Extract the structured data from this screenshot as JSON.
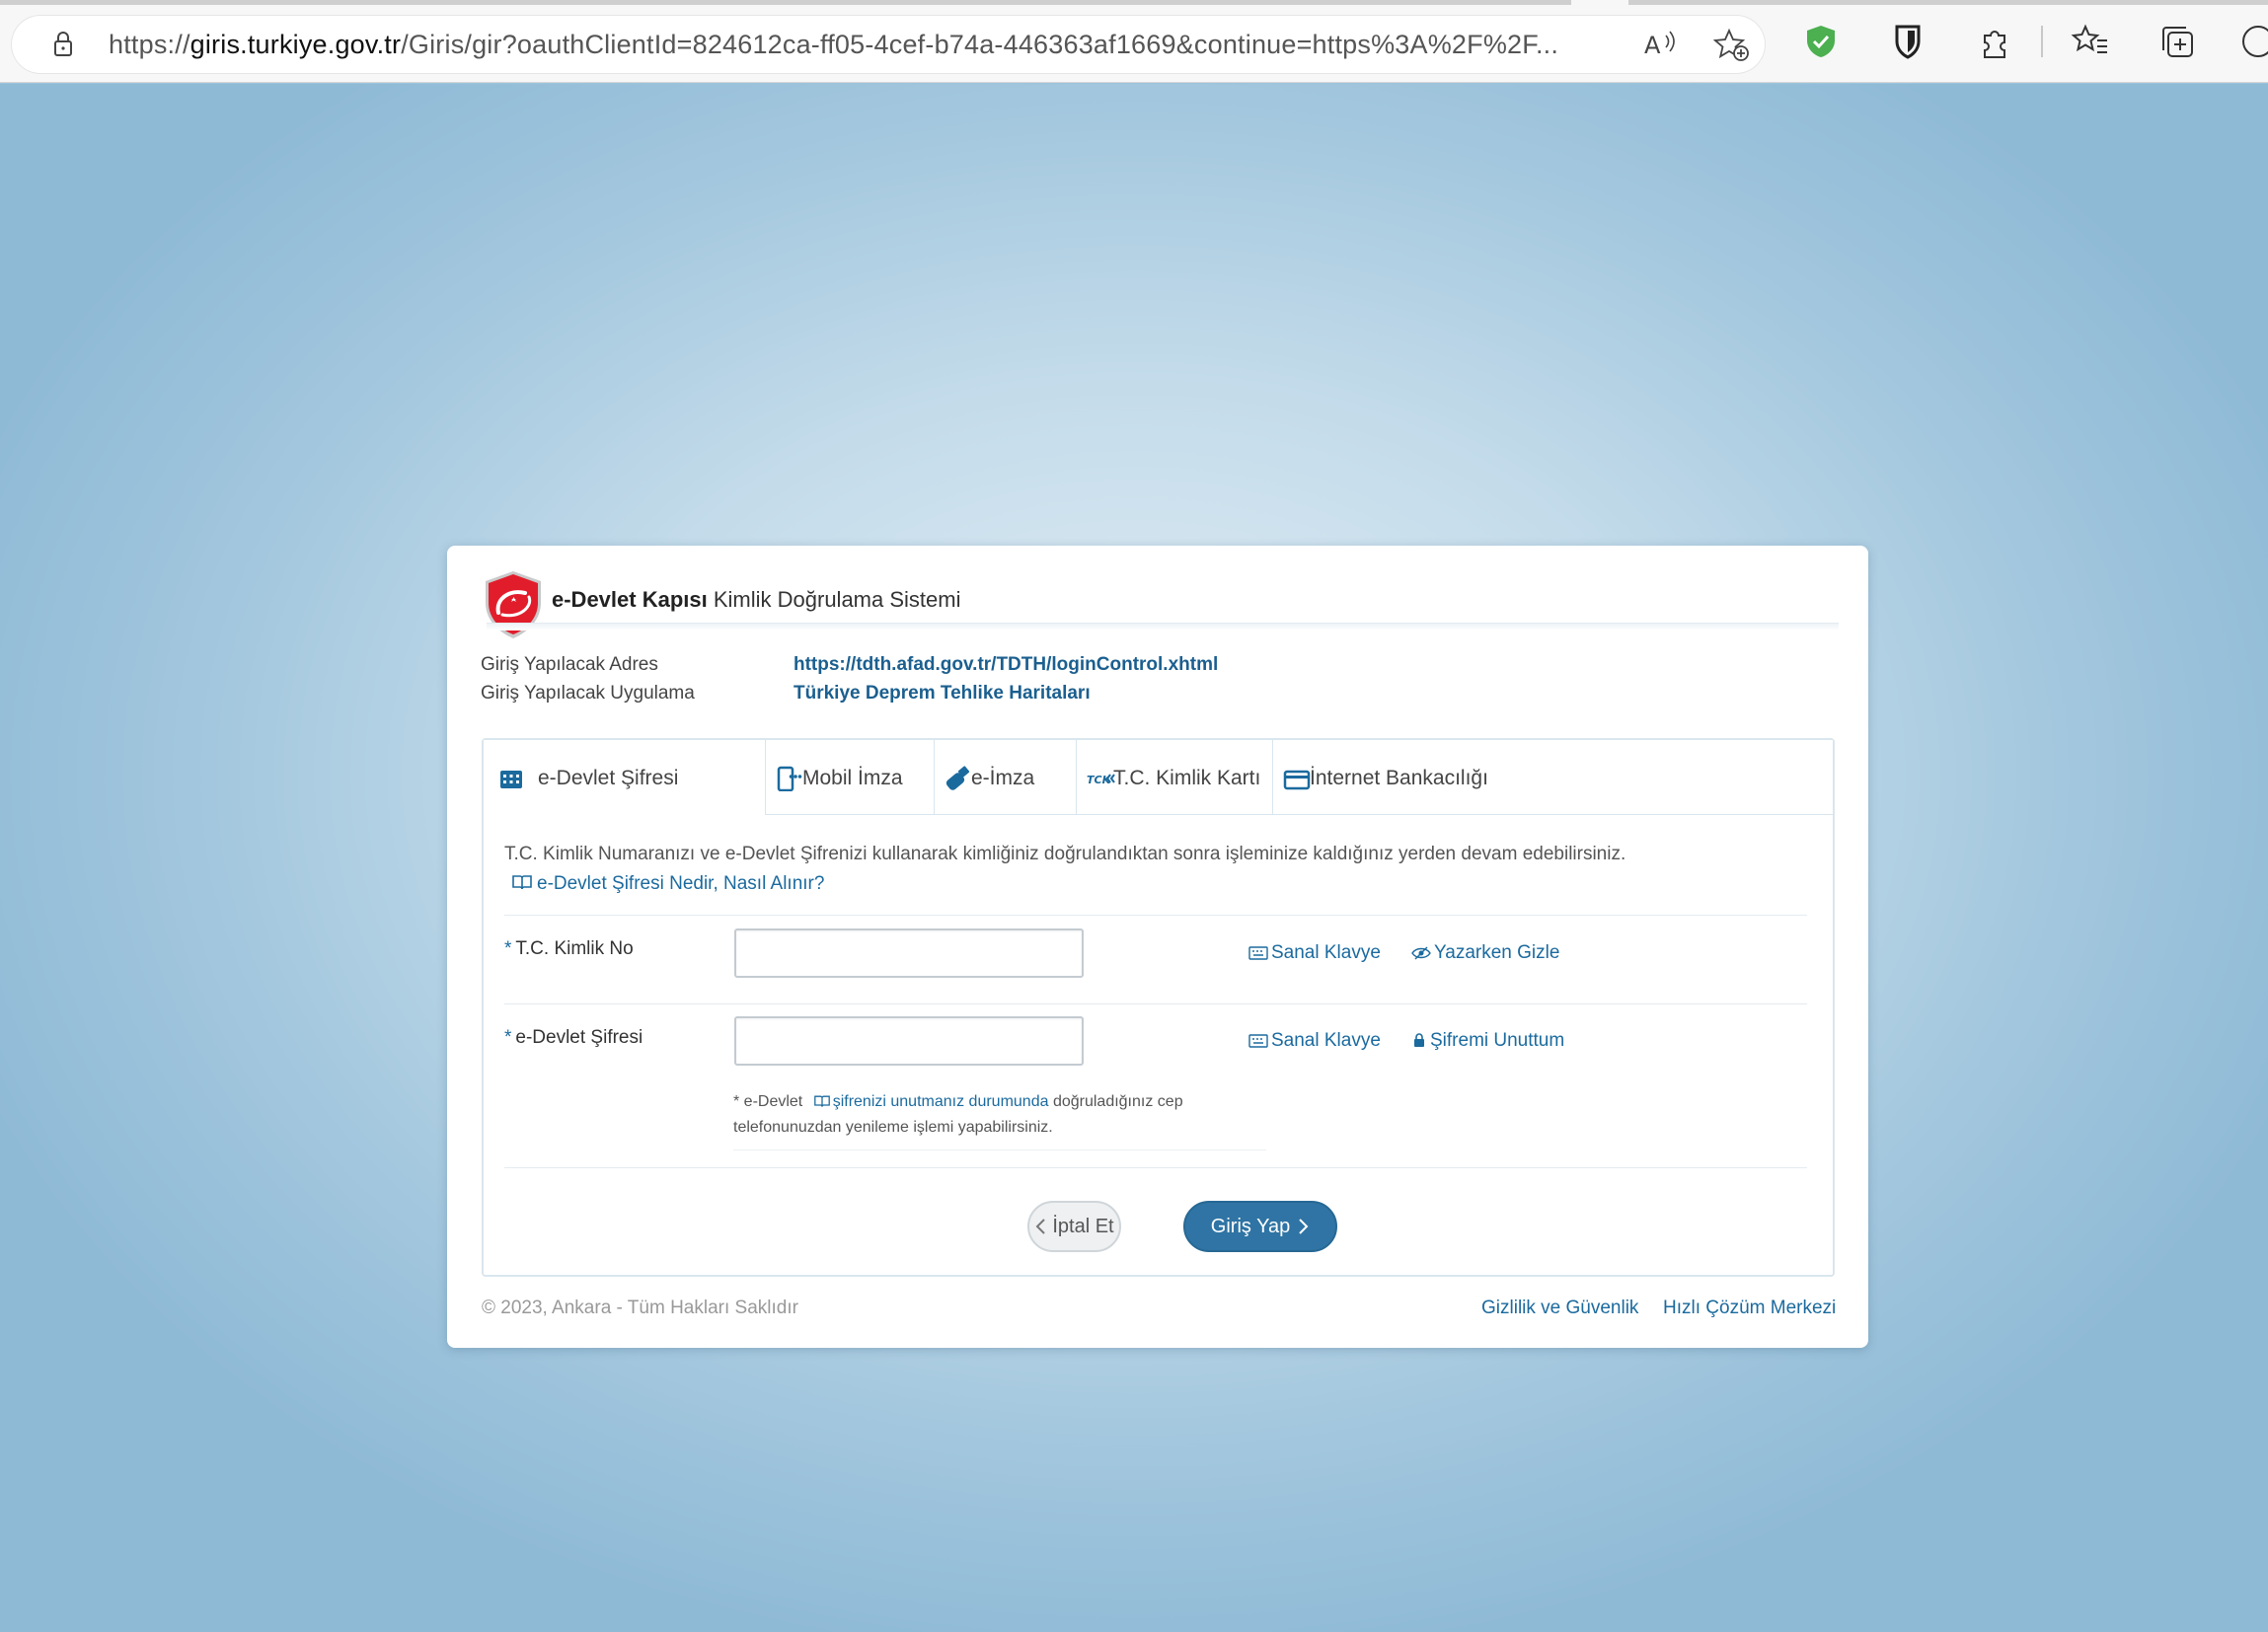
{
  "browser": {
    "url_prefix": "https://",
    "url_host": "giris.turkiye.gov.tr",
    "url_rest": "/Giris/gir?oauthClientId=824612ca-ff05-4cef-b74a-446363af1669&continue=https%3A%2F%2F...",
    "toolbar_icons": [
      "read-aloud-icon",
      "add-favorite-icon",
      "shield-extension-icon",
      "bitwarden-icon",
      "extensions-icon",
      "favorites-icon",
      "collections-icon",
      "profile-icon"
    ]
  },
  "header": {
    "brand_bold": "e-Devlet Kapısı",
    "brand_rest": "Kimlik Doğrulama Sistemi"
  },
  "info": {
    "address_label": "Giriş Yapılacak Adres",
    "address_value": "https://tdth.afad.gov.tr/TDTH/loginControl.xhtml",
    "app_label": "Giriş Yapılacak Uygulama",
    "app_value": "Türkiye Deprem Tehlike Haritaları"
  },
  "tabs": [
    {
      "label": "e-Devlet Şifresi",
      "icon": "keypad-icon",
      "active": true
    },
    {
      "label": "Mobil İmza",
      "icon": "mobile-signature-icon",
      "active": false
    },
    {
      "label": "e-İmza",
      "icon": "usb-token-icon",
      "active": false
    },
    {
      "label": "T.C. Kimlik Kartı",
      "icon": "id-card-icon",
      "active": false
    },
    {
      "label": "İnternet Bankacılığı",
      "icon": "bank-card-icon",
      "active": false
    }
  ],
  "form": {
    "description": "T.C. Kimlik Numaranızı ve e-Devlet Şifrenizi kullanarak kimliğiniz doğrulandıktan sonra işleminize kaldığınız yerden devam edebilirsiniz.",
    "help_link": "e-Devlet Şifresi Nedir, Nasıl Alınır?",
    "required_mark": "*",
    "tc_label": "T.C. Kimlik No",
    "tc_value": "",
    "password_label": "e-Devlet Şifresi",
    "password_value": "",
    "virtual_keyboard": "Sanal Klavye",
    "hide_while_typing": "Yazarken Gizle",
    "forgot_password": "Şifremi Unuttum",
    "note_start": "* e-Devlet",
    "note_link": "şifrenizi unutmanız durumunda",
    "note_end": "doğruladığınız cep telefonunuzdan yenileme işlemi yapabilirsiniz.",
    "cancel_button": "İptal Et",
    "login_button": "Giriş Yap"
  },
  "footer": {
    "copyright": "© 2023, Ankara - Tüm Hakları Saklıdır",
    "privacy_link": "Gizlilik ve Güvenlik",
    "help_center_link": "Hızlı Çözüm Merkezi"
  },
  "colors": {
    "accent": "#1b6a9e",
    "button_primary": "#2f74a4",
    "logo_red": "#e21d2b"
  }
}
